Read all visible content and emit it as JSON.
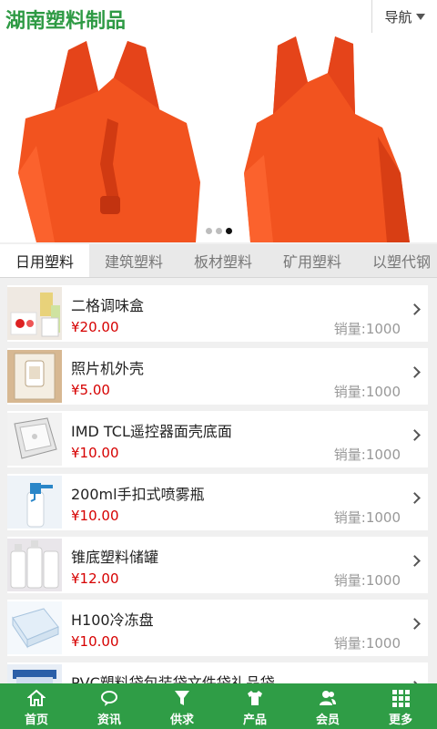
{
  "header": {
    "logo": "湖南塑料制品",
    "nav_label": "导航"
  },
  "banner": {
    "slides": 3,
    "active_slide": 3,
    "image": "orange plastic vest shopping bags"
  },
  "tabs": [
    {
      "label": "日用塑料",
      "active": true
    },
    {
      "label": "建筑塑料",
      "active": false
    },
    {
      "label": "板材塑料",
      "active": false
    },
    {
      "label": "矿用塑料",
      "active": false
    },
    {
      "label": "以塑代钢",
      "active": false
    }
  ],
  "products": [
    {
      "name": "二格调味盒",
      "price": "¥20.00",
      "sales": "销量:1000"
    },
    {
      "name": "照片机外壳",
      "price": "¥5.00",
      "sales": "销量:1000"
    },
    {
      "name": "IMD TCL遥控器面壳底面",
      "price": "¥10.00",
      "sales": "销量:1000"
    },
    {
      "name": "200ml手扣式喷雾瓶",
      "price": "¥10.00",
      "sales": "销量:1000"
    },
    {
      "name": "锥底塑料储罐",
      "price": "¥12.00",
      "sales": "销量:1000"
    },
    {
      "name": "H100冷冻盘",
      "price": "¥10.00",
      "sales": "销量:1000"
    },
    {
      "name": "PVC塑料袋包装袋文件袋礼品袋",
      "price": "",
      "sales": ""
    }
  ],
  "footer": [
    {
      "label": "首页",
      "icon": "home-icon"
    },
    {
      "label": "资讯",
      "icon": "chat-bubble-icon"
    },
    {
      "label": "供求",
      "icon": "funnel-icon"
    },
    {
      "label": "产品",
      "icon": "shirt-icon"
    },
    {
      "label": "会员",
      "icon": "users-icon"
    },
    {
      "label": "更多",
      "icon": "grid-icon"
    }
  ],
  "colors": {
    "brand_green": "#2e9a44",
    "price_red": "#d60000",
    "footer_green": "#2f9d46"
  }
}
